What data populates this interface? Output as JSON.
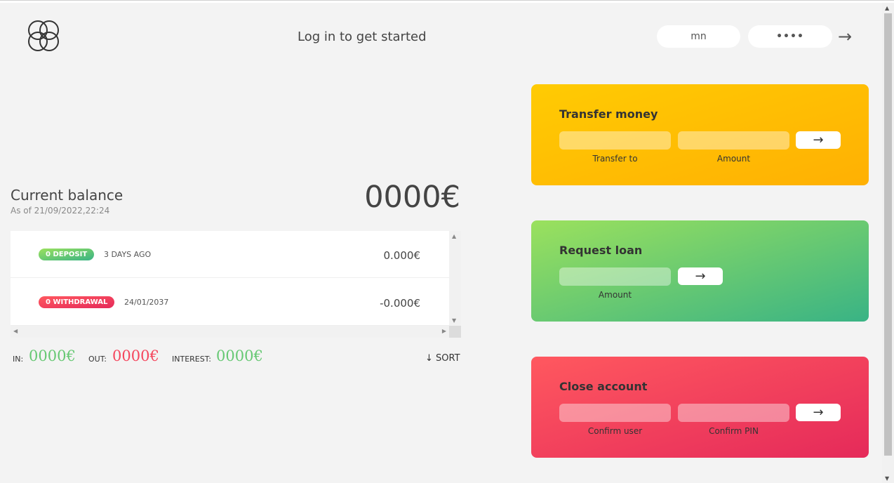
{
  "header": {
    "welcome": "Log in to get started",
    "login_user_value": "mn",
    "login_pin_value": "••••",
    "login_button": "→"
  },
  "balance": {
    "label": "Current balance",
    "date": "As of 21/09/2022,22:24",
    "value": "0000€"
  },
  "movements": [
    {
      "type_label": "0 DEPOSIT",
      "kind": "deposit",
      "date": "3 DAYS AGO",
      "value": "0.000€"
    },
    {
      "type_label": "0 WITHDRAWAL",
      "kind": "withdrawal",
      "date": "24/01/2037",
      "value": "-0.000€"
    }
  ],
  "summary": {
    "in_label": "In:",
    "in_value": "0000€",
    "out_label": "Out:",
    "out_value": "0000€",
    "interest_label": "Interest:",
    "interest_value": "0000€",
    "sort_label": "↓ SORT"
  },
  "operations": {
    "transfer": {
      "title": "Transfer money",
      "label_to": "Transfer to",
      "label_amount": "Amount",
      "button": "→"
    },
    "loan": {
      "title": "Request loan",
      "label_amount": "Amount",
      "button": "→"
    },
    "close": {
      "title": "Close account",
      "label_user": "Confirm user",
      "label_pin": "Confirm PIN",
      "button": "→"
    }
  },
  "colors": {
    "deposit": "#66c873",
    "withdrawal": "#f5465d",
    "transfer_card": "#ffb003",
    "loan_card": "#39b385",
    "close_card": "#e52a5a"
  }
}
